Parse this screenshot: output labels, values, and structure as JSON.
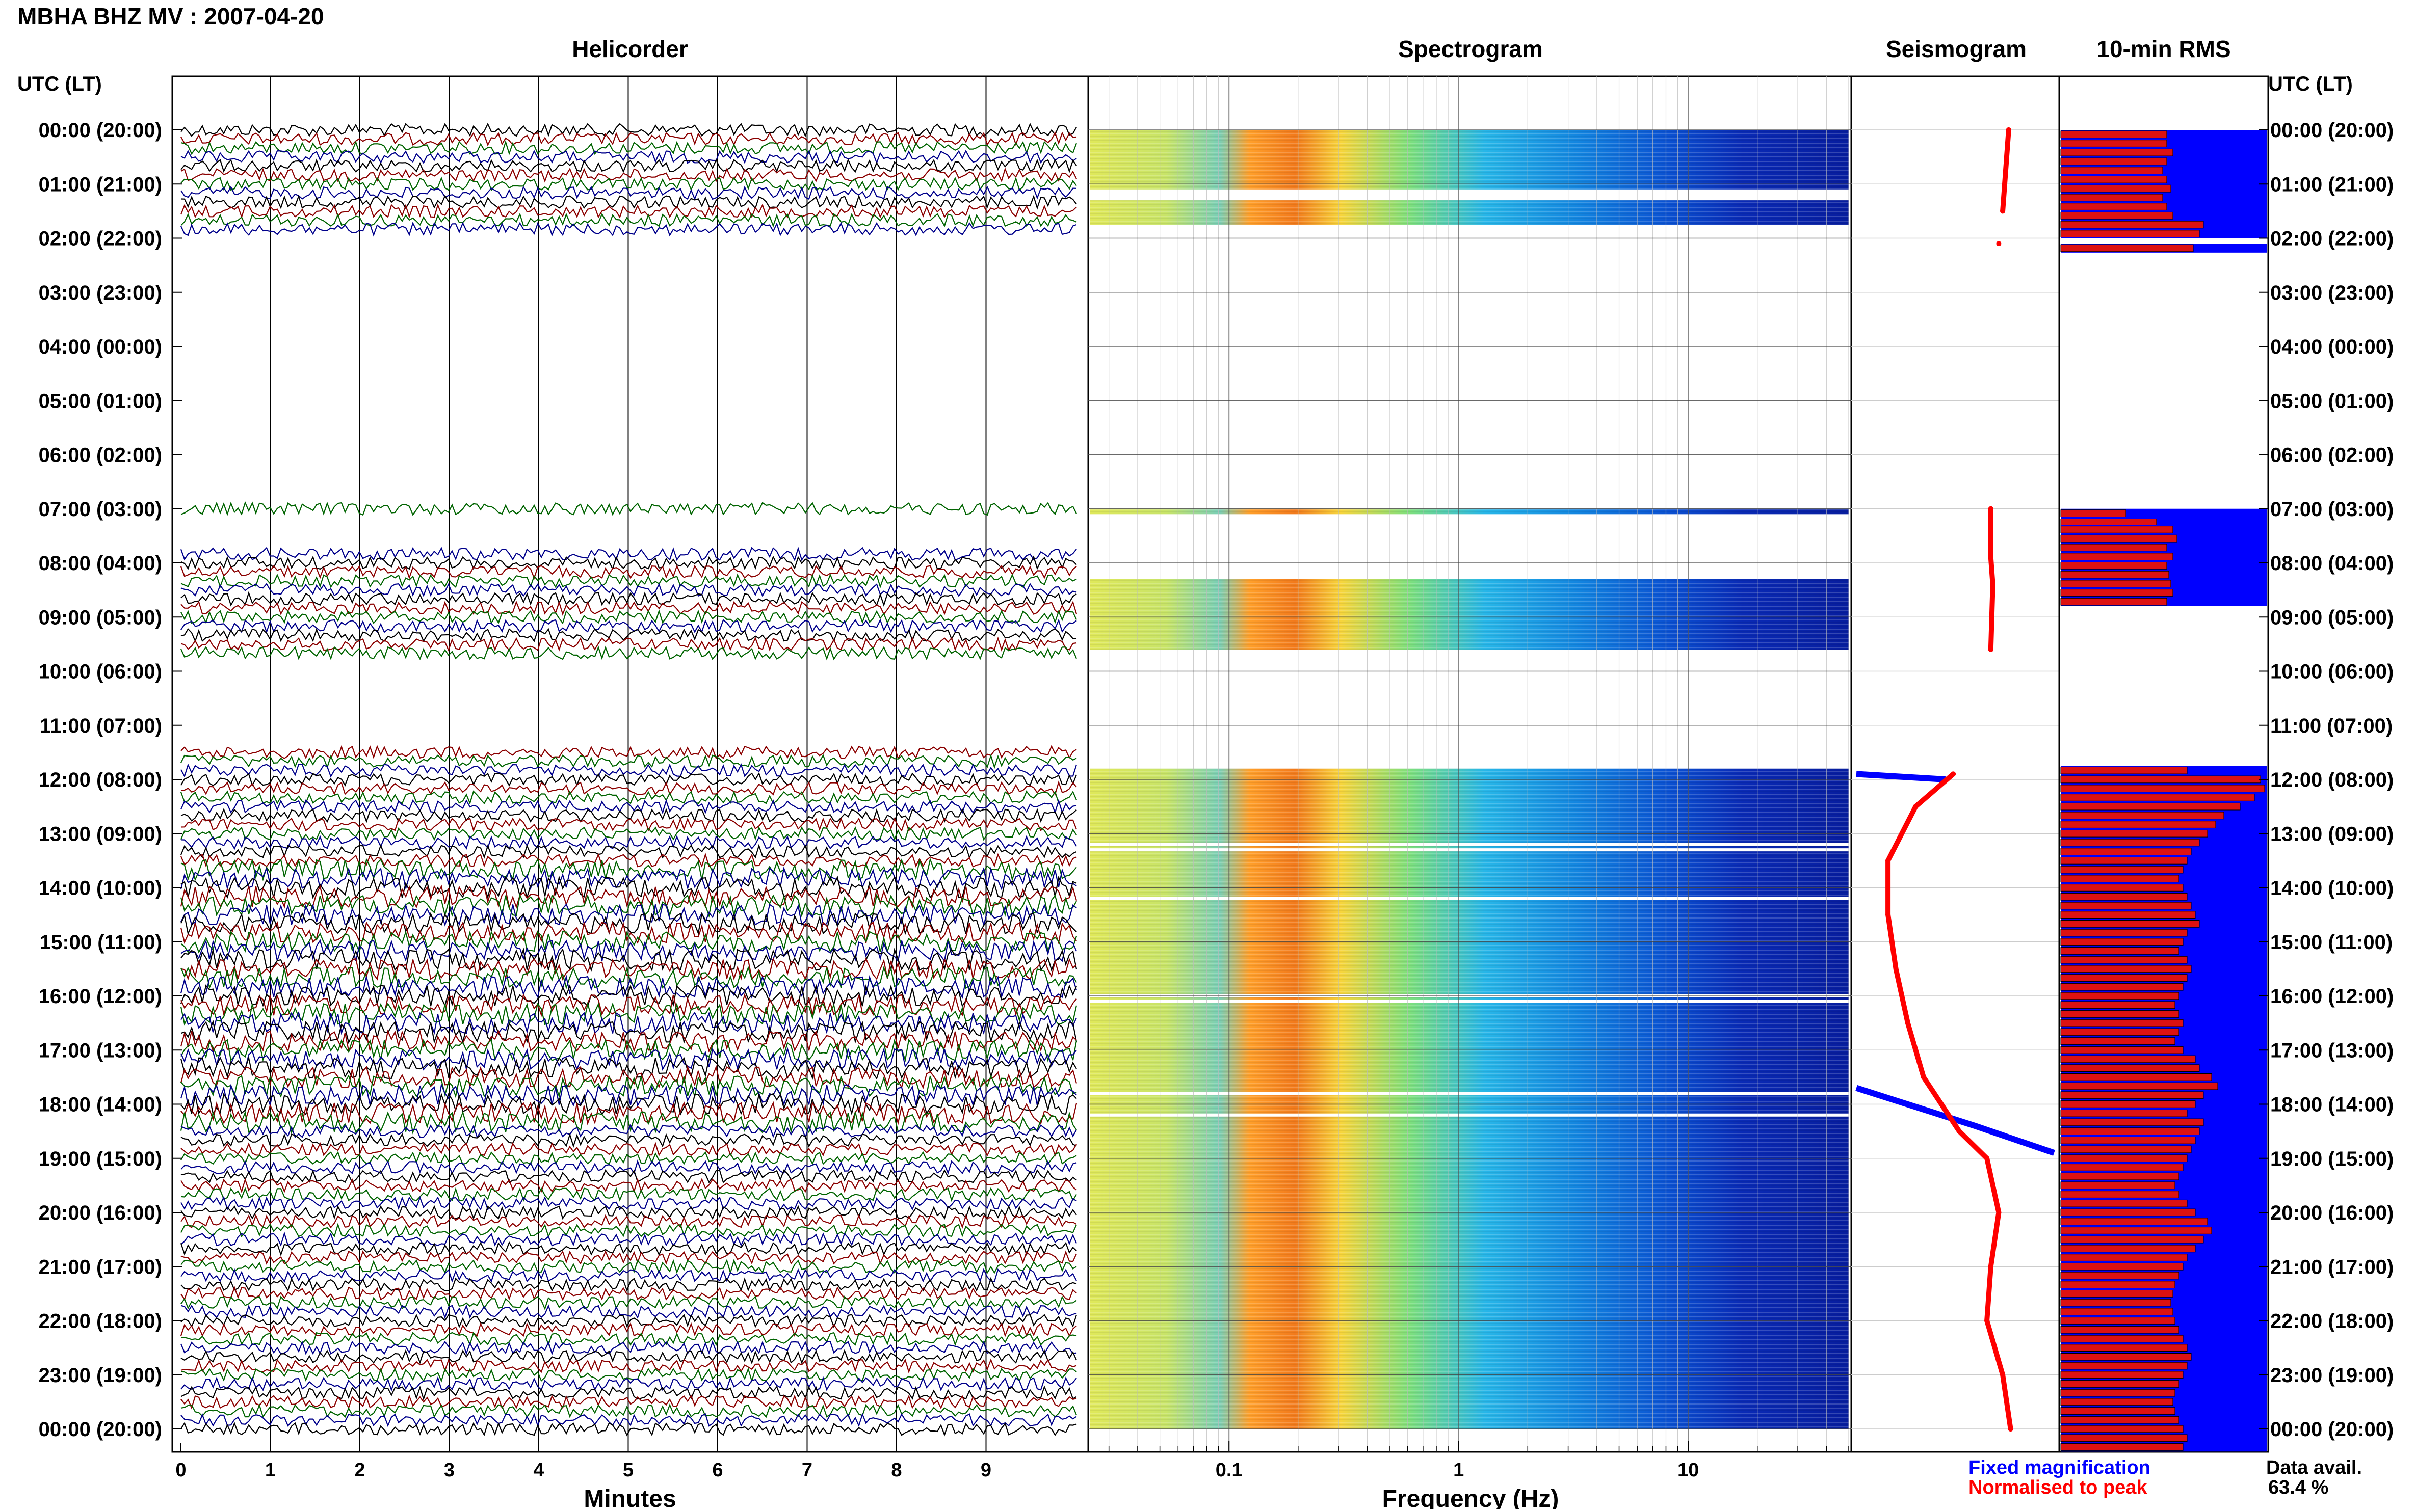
{
  "header": {
    "title": "MBHA BHZ MV : 2007-04-20",
    "panel_titles": [
      "Helicorder",
      "Spectrogram",
      "Seismogram",
      "10-min RMS"
    ],
    "axis_heading_left": "UTC (LT)",
    "axis_heading_right": "UTC (LT)"
  },
  "time_labels": [
    "00:00 (20:00)",
    "01:00 (21:00)",
    "02:00 (22:00)",
    "03:00 (23:00)",
    "04:00 (00:00)",
    "05:00 (01:00)",
    "06:00 (02:00)",
    "07:00 (03:00)",
    "08:00 (04:00)",
    "09:00 (05:00)",
    "10:00 (06:00)",
    "11:00 (07:00)",
    "12:00 (08:00)",
    "13:00 (09:00)",
    "14:00 (10:00)",
    "15:00 (11:00)",
    "16:00 (12:00)",
    "17:00 (13:00)",
    "18:00 (14:00)",
    "19:00 (15:00)",
    "20:00 (16:00)",
    "21:00 (17:00)",
    "22:00 (18:00)",
    "23:00 (19:00)",
    "00:00 (20:00)"
  ],
  "footer": {
    "helicorder_xlabel": "Minutes",
    "spectrogram_xlabel": "Frequency (Hz)",
    "legend_fixed": "Fixed magnification",
    "legend_normalised": "Normalised to peak",
    "data_avail_label": "Data avail.",
    "data_avail_value": "63.4 %"
  },
  "colors": {
    "trace_cycle": [
      "#000000",
      "#8b0000",
      "#006400",
      "#00008b"
    ],
    "fixed_magnification": "#0000ff",
    "normalised_to_peak": "#ff0000",
    "rms_background": "#0000ff",
    "rms_bar": "#dd1111"
  },
  "chart_data": [
    {
      "type": "line",
      "name": "helicorder",
      "x_ticks": [
        "0",
        "1",
        "2",
        "3",
        "4",
        "5",
        "6",
        "7",
        "8",
        "9"
      ],
      "xlim": [
        0,
        10
      ],
      "xlabel": "Minutes",
      "rows_per_hour": 6,
      "data_hour_ranges": [
        [
          0,
          1.75
        ],
        [
          7.0,
          7.05
        ],
        [
          7.8,
          9.65
        ],
        [
          11.5,
          24.0
        ]
      ],
      "grid": true
    },
    {
      "type": "heatmap",
      "name": "spectrogram",
      "x_ticks": [
        "0.1",
        "1",
        "10"
      ],
      "x_tick_values": [
        0.1,
        1,
        10
      ],
      "xlim": [
        0.025,
        50
      ],
      "x_scale": "log",
      "xlabel": "Frequency (Hz)",
      "data_hour_ranges": [
        [
          0,
          1.1
        ],
        [
          1.3,
          1.75
        ],
        [
          7.0,
          7.1
        ],
        [
          8.3,
          9.6
        ],
        [
          11.8,
          24.0
        ]
      ],
      "peak_band_hz": [
        0.15,
        0.4
      ],
      "gap_hours": [
        13.2,
        13.3,
        14.2,
        16.0,
        16.1,
        17.8,
        18.2
      ]
    },
    {
      "type": "line",
      "name": "seismogram",
      "series": [
        {
          "name": "Fixed magnification",
          "hours": [
            11.9,
            12.0,
            17.7,
            18.4,
            18.9
          ],
          "values": [
            0.0,
            0.45,
            0.0,
            0.6,
            1.0
          ]
        },
        {
          "name": "Normalised to peak",
          "hours": [
            0.0,
            1.5,
            2.1,
            7.0,
            7.9,
            8.4,
            9.6,
            11.9,
            12.5,
            13.5,
            14.5,
            15.5,
            16.5,
            17.5,
            18.5,
            19.0,
            20.0,
            21.0,
            22.0,
            23.0,
            24.0
          ],
          "values": [
            0.77,
            0.74,
            0.72,
            0.68,
            0.68,
            0.69,
            0.68,
            0.49,
            0.3,
            0.16,
            0.16,
            0.2,
            0.26,
            0.34,
            0.52,
            0.66,
            0.72,
            0.68,
            0.66,
            0.74,
            0.78
          ]
        }
      ]
    },
    {
      "type": "bar",
      "name": "10-min RMS",
      "orientation": "horizontal",
      "segments": [
        {
          "start_hour": 0.0,
          "values": [
            0.52,
            0.52,
            0.55,
            0.52,
            0.5,
            0.52,
            0.54,
            0.5,
            0.52,
            0.55,
            0.7,
            0.68
          ]
        },
        {
          "start_hour": 2.1,
          "values": [
            0.65
          ]
        },
        {
          "start_hour": 7.0,
          "values": [
            0.32,
            0.47
          ]
        },
        {
          "start_hour": 7.3,
          "values": [
            0.55,
            0.57,
            0.52,
            0.55,
            0.52,
            0.53,
            0.54,
            0.55,
            0.52
          ]
        },
        {
          "start_hour": 11.75,
          "values": [
            0.62,
            0.98,
            1.0,
            0.95,
            0.88,
            0.8,
            0.76,
            0.72,
            0.68,
            0.64,
            0.62,
            0.6,
            0.58,
            0.6,
            0.62,
            0.64,
            0.66,
            0.68,
            0.62,
            0.6,
            0.58,
            0.62,
            0.64,
            0.62,
            0.6,
            0.58,
            0.56,
            0.58,
            0.6,
            0.58,
            0.56,
            0.6,
            0.66,
            0.68,
            0.74,
            0.77,
            0.7,
            0.66,
            0.62,
            0.7,
            0.68,
            0.66,
            0.64,
            0.62,
            0.6,
            0.58,
            0.56,
            0.58,
            0.62,
            0.66,
            0.72,
            0.74,
            0.7,
            0.66,
            0.62,
            0.6,
            0.58,
            0.56,
            0.55,
            0.54,
            0.55,
            0.56,
            0.58,
            0.6,
            0.62,
            0.64,
            0.62,
            0.6,
            0.58,
            0.56,
            0.55,
            0.56,
            0.58,
            0.6,
            0.62,
            0.6
          ]
        }
      ]
    }
  ]
}
